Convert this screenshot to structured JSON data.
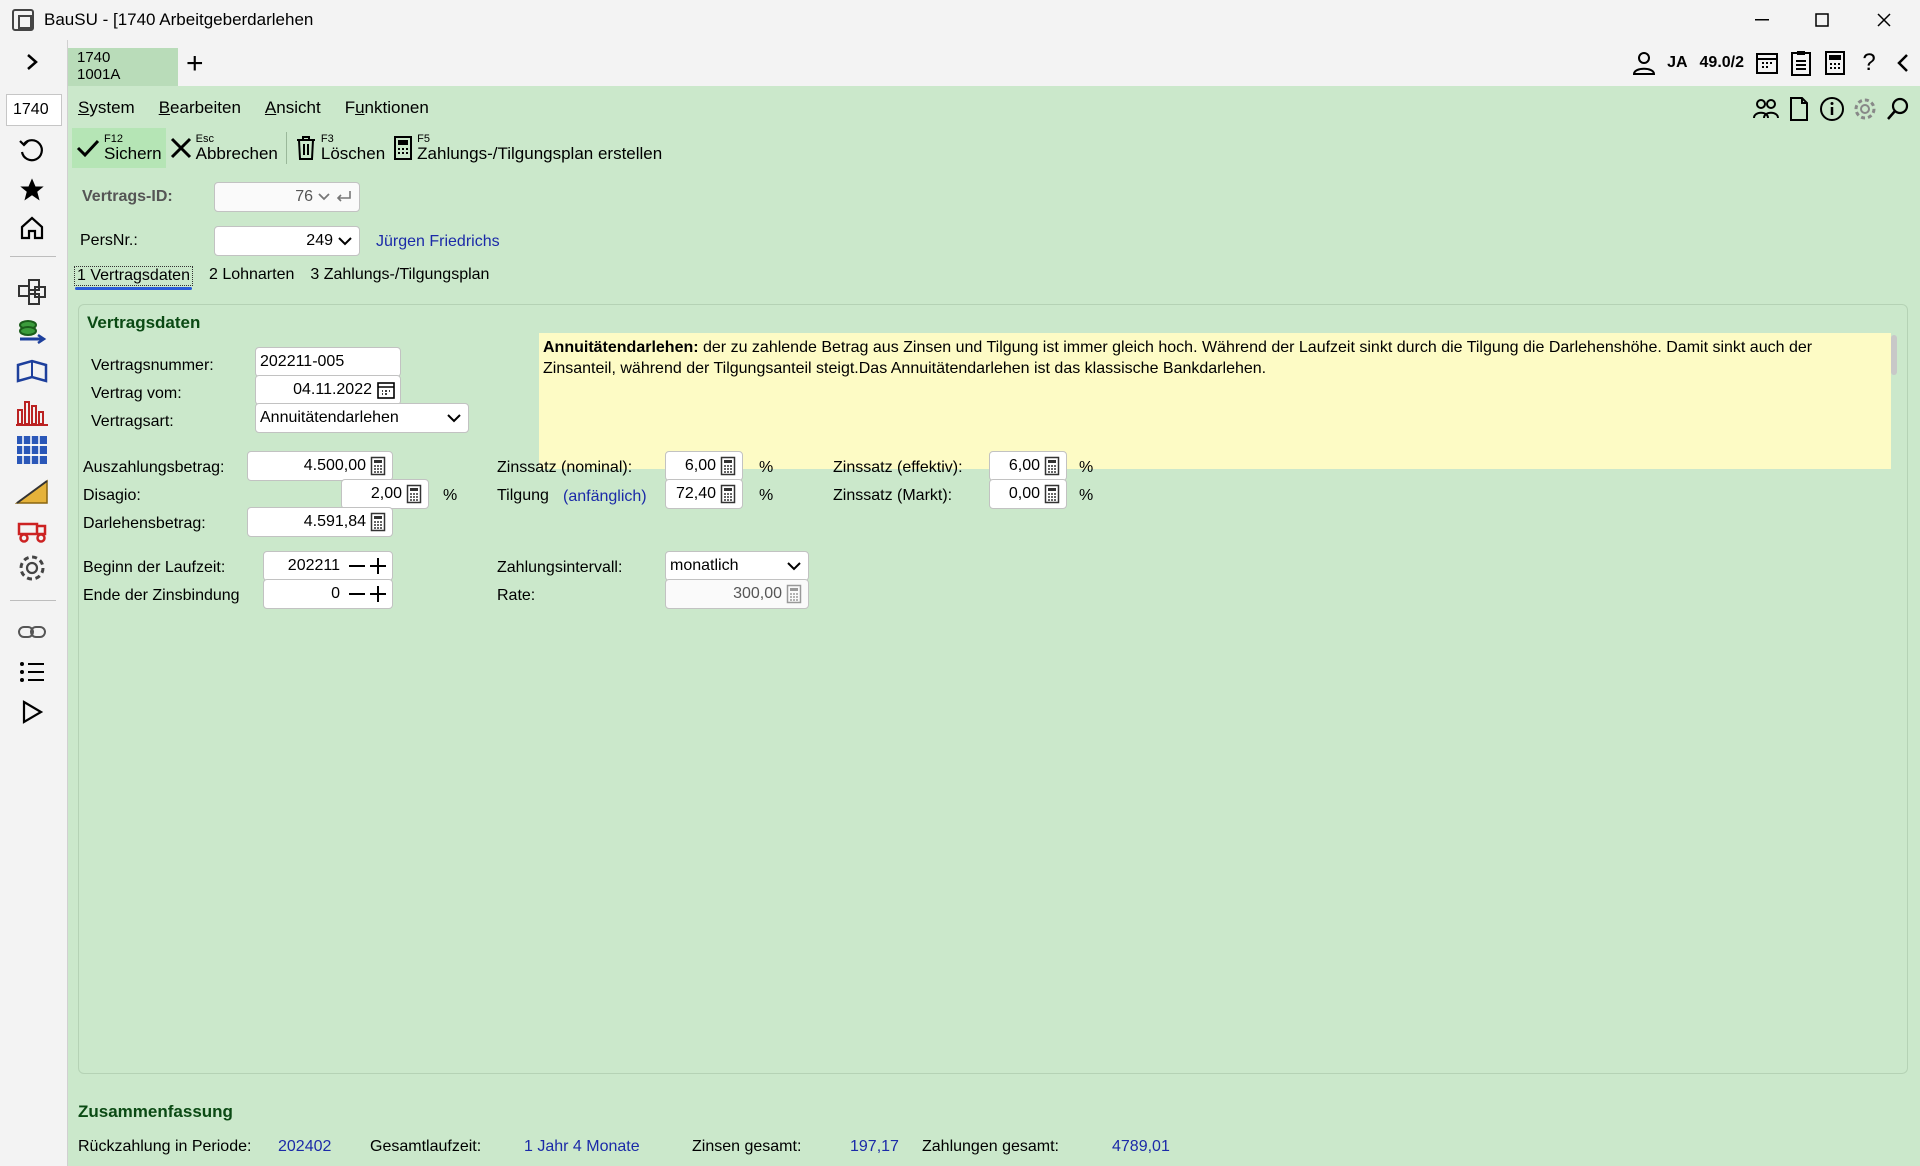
{
  "window": {
    "title": "BauSU - [1740 Arbeitgeberdarlehen"
  },
  "rail": {
    "number": "1740"
  },
  "tab": {
    "line1": "1740",
    "line2": "1001A",
    "add": "+"
  },
  "topright": {
    "user": "JA",
    "version": "49.0/2",
    "help": "?"
  },
  "menu": {
    "system": "ystem",
    "system_u": "S",
    "bearbeiten": "earbeiten",
    "bearbeiten_u": "B",
    "ansicht": "nsicht",
    "ansicht_u": "A",
    "funktionen_a": "F",
    "funktionen_u": "u",
    "funktionen_b": "nktionen"
  },
  "toolbar": {
    "save_key": "F12",
    "save": "Sichern",
    "cancel_key": "Esc",
    "cancel": "Abbrechen",
    "delete_key": "F3",
    "delete": "Löschen",
    "plan_key": "F5",
    "plan": "Zahlungs-/Tilgungsplan erstellen"
  },
  "header": {
    "vertrags_id_label": "Vertrags-ID:",
    "vertrags_id": "76",
    "persnr_label": "PersNr.:",
    "persnr": "249",
    "person_name": "Jürgen Friedrichs"
  },
  "tabs": [
    "1 Vertragsdaten",
    "2 Lohnarten",
    "3 Zahlungs-/Tilgungsplan"
  ],
  "panel": {
    "title": "Vertragsdaten",
    "info_bold": "Annuitätendarlehen:",
    "info_text": " der zu zahlende Betrag aus Zinsen und Tilgung ist immer gleich hoch. Während der Laufzeit sinkt durch die Tilgung die Darlehenshöhe. Damit sinkt auch der Zinsanteil, während der Tilgungsanteil steigt.Das Annuitätendarlehen ist das klassische Bankdarlehen.",
    "vertragsnummer_label": "Vertragsnummer:",
    "vertragsnummer": "202211-005",
    "vertrag_vom_label": "Vertrag vom:",
    "vertrag_vom": "04.11.2022",
    "vertragsart_label": "Vertragsart:",
    "vertragsart": "Annuitätendarlehen",
    "auszahlung_label": "Auszahlungsbetrag:",
    "auszahlung": "4.500,00",
    "disagio_label": "Disagio:",
    "disagio": "2,00",
    "pct": "%",
    "darlehen_label": "Darlehensbetrag:",
    "darlehen": "4.591,84",
    "zins_nom_label": "Zinssatz (nominal):",
    "zins_nom": "6,00",
    "tilgung_label": "Tilgung",
    "tilgung_sub": "(anfänglich)",
    "tilgung": "72,40",
    "zins_eff_label": "Zinssatz (effektiv):",
    "zins_eff": "6,00",
    "zins_markt_label": "Zinssatz (Markt):",
    "zins_markt": "0,00",
    "beginn_label": "Beginn der Laufzeit:",
    "beginn": "202211",
    "ende_label": "Ende der Zinsbindung",
    "ende": "0",
    "intervall_label": "Zahlungsintervall:",
    "intervall": "monatlich",
    "rate_label": "Rate:",
    "rate": "300,00"
  },
  "summary": {
    "title": "Zusammenfassung",
    "rueck_label": "Rückzahlung in Periode:",
    "rueck": "202402",
    "laufzeit_label": "Gesamtlaufzeit:",
    "laufzeit": "1 Jahr 4 Monate",
    "zinsen_label": "Zinsen gesamt:",
    "zinsen": "197,17",
    "zahlungen_label": "Zahlungen gesamt:",
    "zahlungen": "4789,01"
  }
}
